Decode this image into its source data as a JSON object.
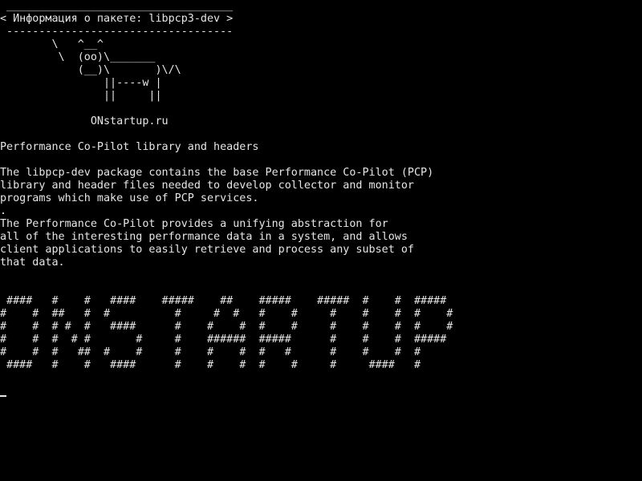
{
  "terminal": {
    "lines": [
      " ___________________________________",
      "< Информация о пакете: libpcp3-dev >",
      " -----------------------------------",
      "        \\   ^__^",
      "         \\  (oo)\\_______",
      "            (__)\\       )\\/\\",
      "                ||----w |",
      "                ||     ||",
      "",
      "              ONstartup.ru",
      "",
      "Performance Co-Pilot library and headers",
      "",
      "The libpcp-dev package contains the base Performance Co-Pilot (PCP)",
      "library and header files needed to develop collector and monitor",
      "programs which make use of PCP services.",
      ".",
      "The Performance Co-Pilot provides a unifying abstraction for",
      "all of the interesting performance data in a system, and allows",
      "client applications to easily retrieve and process any subset of",
      "that data.",
      "",
      "",
      " ####   #    #   ####    #####    ##    #####    #####  #    #  #####",
      "#    #  ##   #  #          #     #  #   #    #     #    #    #  #    #",
      "#    #  # #  #   ####      #    #    #  #    #     #    #    #  #    #",
      "#    #  #  # #       #     #    ######  #####      #    #    #  #####",
      "#    #  #   ##  #    #     #    #    #  #   #      #    #    #  #",
      " ####   #    #   ####      #    #    #  #    #     #     ####   #"
    ]
  }
}
